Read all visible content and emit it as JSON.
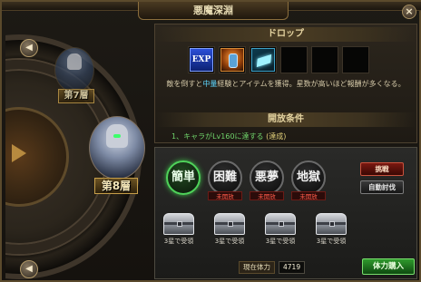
{
  "window": {
    "title": "悪魔深淵",
    "close_label": "×"
  },
  "stages": {
    "prev_label": "7",
    "current_label": "8",
    "prev_arrow": "◀",
    "next_arrow": "◀"
  },
  "stage_labels": {
    "prev": "第7層",
    "current": "第8層"
  },
  "drop": {
    "header": "ドロップ",
    "items": [
      "EXP",
      "armor-icon",
      "gem-icon",
      "",
      "",
      ""
    ],
    "desc_prefix": "敵を倒すと",
    "desc_em": "中量",
    "desc_suffix": "経験とアイテムを獲得。星数が高いほど報酬が多くなる。"
  },
  "condition": {
    "header": "開放条件",
    "item": "1、キャラがLv160に達する",
    "status": "(達成)"
  },
  "difficulty": {
    "buttons": [
      "簡単",
      "困難",
      "悪夢",
      "地獄"
    ],
    "selected": 0,
    "unlock_label": "未開放",
    "challenge_label": "挑戦",
    "auto_label": "自動討伐"
  },
  "chests": [
    {
      "label": "3星で受領"
    },
    {
      "label": "3星で受領"
    },
    {
      "label": "3星で受領"
    },
    {
      "label": "3星で受領"
    }
  ],
  "stamina": {
    "label": "現在体力",
    "value": "4719",
    "buy_label": "体力購入"
  },
  "colors": {
    "accent_green": "#4fd35a",
    "warning_red": "#ff5a4a",
    "drop_highlight": "#5fd7ff"
  }
}
